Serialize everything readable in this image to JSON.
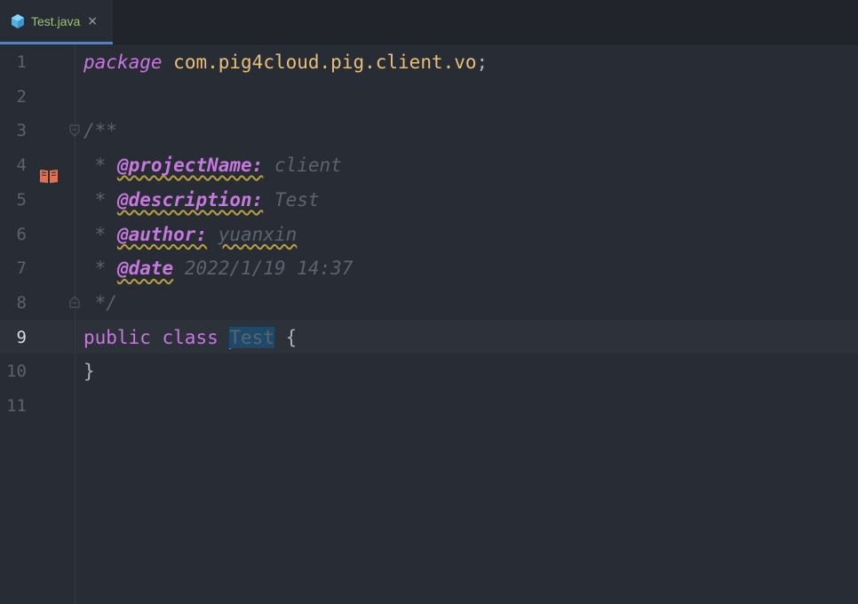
{
  "tab": {
    "filename": "Test.java",
    "close_glyph": "×",
    "icon": "java-class-icon",
    "accent_color": "#3e86e0"
  },
  "editor": {
    "current_line": 9,
    "lines": [
      {
        "number": "1",
        "segments": [
          {
            "text": "package",
            "style": "kw-i"
          },
          {
            "text": " "
          },
          {
            "text": "com.pig4cloud.pig.client.vo",
            "style": "pkg"
          },
          {
            "text": ";"
          }
        ]
      },
      {
        "number": "2",
        "segments": []
      },
      {
        "number": "3",
        "segments": [
          {
            "text": "/**",
            "style": "cm"
          }
        ]
      },
      {
        "number": "4",
        "segments": [
          {
            "text": " * ",
            "style": "cm"
          },
          {
            "text": "@projectName:",
            "style": "tag"
          },
          {
            "text": " client",
            "style": "cm"
          }
        ]
      },
      {
        "number": "5",
        "segments": [
          {
            "text": " * ",
            "style": "cm"
          },
          {
            "text": "@description:",
            "style": "tag"
          },
          {
            "text": " Test",
            "style": "cm"
          }
        ]
      },
      {
        "number": "6",
        "segments": [
          {
            "text": " * ",
            "style": "cm"
          },
          {
            "text": "@author:",
            "style": "tag"
          },
          {
            "text": " "
          },
          {
            "text": "yuanxin",
            "style": "cm wavy"
          }
        ]
      },
      {
        "number": "7",
        "segments": [
          {
            "text": " * ",
            "style": "cm"
          },
          {
            "text": "@date",
            "style": "tag"
          },
          {
            "text": " 2022/1/19 14:37",
            "style": "cm"
          }
        ]
      },
      {
        "number": "8",
        "segments": [
          {
            "text": " */",
            "style": "cm"
          }
        ]
      },
      {
        "number": "9",
        "segments": [
          {
            "text": "public",
            "style": "kw"
          },
          {
            "text": " "
          },
          {
            "text": "class",
            "style": "kw"
          },
          {
            "text": " "
          },
          {
            "text": "",
            "style": "caret"
          },
          {
            "text": "Test",
            "style": "sel"
          },
          {
            "text": " {"
          }
        ]
      },
      {
        "number": "10",
        "segments": [
          {
            "text": "}"
          }
        ]
      },
      {
        "number": "11",
        "segments": []
      }
    ]
  },
  "gutter_icons": {
    "bookmark": "book-icon",
    "fold_start": "fold-collapse-icon",
    "fold_end": "fold-end-icon"
  }
}
